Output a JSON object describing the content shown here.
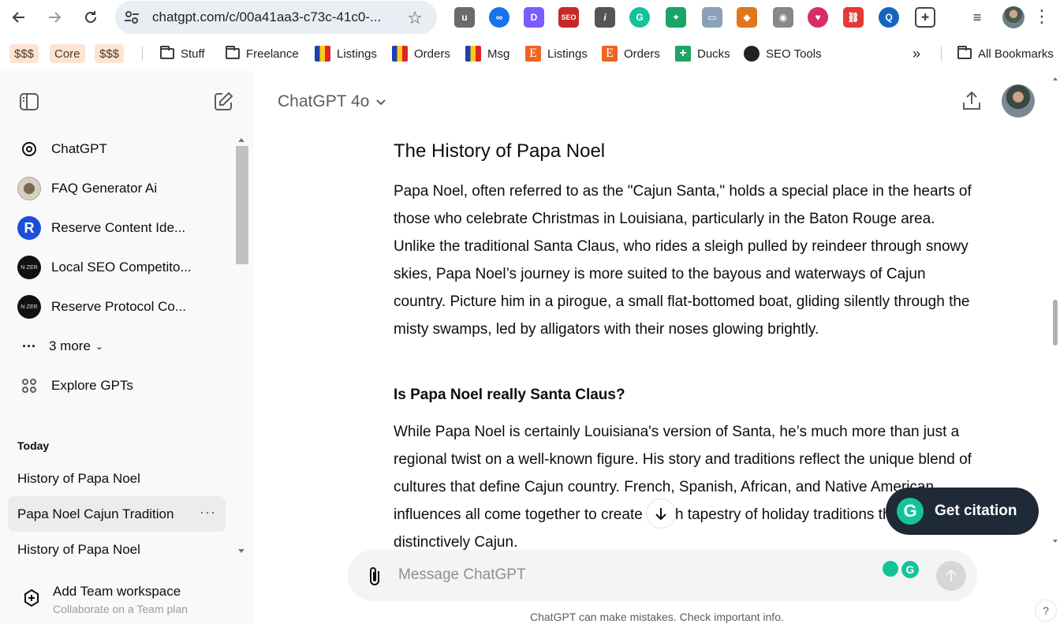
{
  "browser": {
    "url": "chatgpt.com/c/00a41aa3-c73c-41c0-...",
    "back_icon": "arrow-left-icon",
    "forward_icon": "arrow-right-icon",
    "reload_icon": "reload-icon"
  },
  "bookmarks": {
    "chips": [
      "$$$",
      "Core",
      "$$$"
    ],
    "items": [
      "Stuff",
      "Freelance",
      "Listings",
      "Orders",
      "Msg",
      "Listings",
      "Orders",
      "Ducks",
      "SEO Tools"
    ],
    "overflow": "»",
    "all": "All Bookmarks"
  },
  "sidebar": {
    "gpts": [
      {
        "label": "ChatGPT"
      },
      {
        "label": "FAQ Generator Ai"
      },
      {
        "label": "Reserve Content Ide..."
      },
      {
        "label": "Local SEO Competito..."
      },
      {
        "label": "Reserve Protocol Co..."
      }
    ],
    "more": "3 more",
    "explore": "Explore GPTs",
    "section": "Today",
    "history": [
      "History of Papa Noel",
      "Papa Noel Cajun Tradition",
      "History of Papa Noel"
    ],
    "team_title": "Add Team workspace",
    "team_sub": "Collaborate on a Team plan"
  },
  "main": {
    "model": "ChatGPT 4o",
    "heading": "The History of Papa Noel",
    "para1": "Papa Noel, often referred to as the \"Cajun Santa,\" holds a special place in the hearts of those who celebrate Christmas in Louisiana, particularly in the Baton Rouge area. Unlike the traditional Santa Claus, who rides a sleigh pulled by reindeer through snowy skies, Papa Noel’s journey is more suited to the bayous and waterways of Cajun country. Picture him in a pirogue, a small flat-bottomed boat, gliding silently through the misty swamps, led by alligators with their noses glowing brightly.",
    "subheading": "Is Papa Noel really Santa Claus?",
    "para2": "While Papa Noel is certainly Louisiana's version of Santa, he’s much more than just a regional twist on a well-known figure. His story and traditions reflect the unique blend of cultures that define Cajun country. French, Spanish, African, and Native American influences all come together to create a rich tapestry of holiday traditions that are distinctively Cajun.",
    "citation": "Get citation",
    "placeholder": "Message ChatGPT",
    "disclaimer": "ChatGPT can make mistakes. Check important info.",
    "help": "?"
  }
}
